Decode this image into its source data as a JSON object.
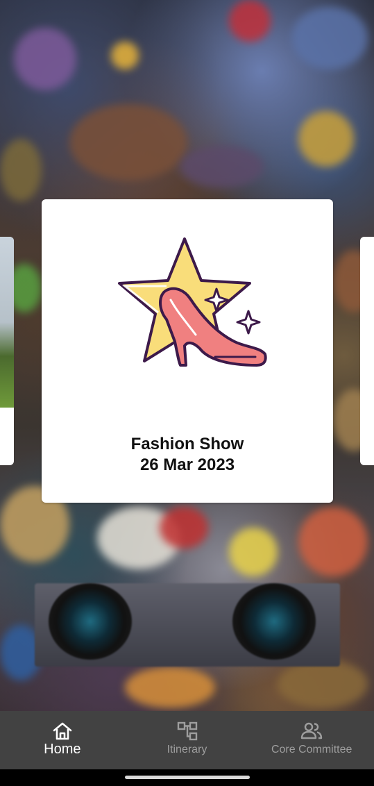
{
  "event_card": {
    "title": "Fashion Show",
    "date": "26 Mar 2023",
    "icon": "high-heel-star-icon"
  },
  "bottom_nav": {
    "items": [
      {
        "label": "Home",
        "icon": "home-icon",
        "active": true
      },
      {
        "label": "Itinerary",
        "icon": "itinerary-icon",
        "active": false
      },
      {
        "label": "Core Committee",
        "icon": "people-icon",
        "active": false
      }
    ]
  },
  "colors": {
    "nav_background": "#424242",
    "nav_active": "#ffffff",
    "nav_inactive": "#9e9e9e",
    "star_fill": "#f9dd7a",
    "shoe_fill": "#f08080",
    "outline": "#3d1a4a"
  }
}
